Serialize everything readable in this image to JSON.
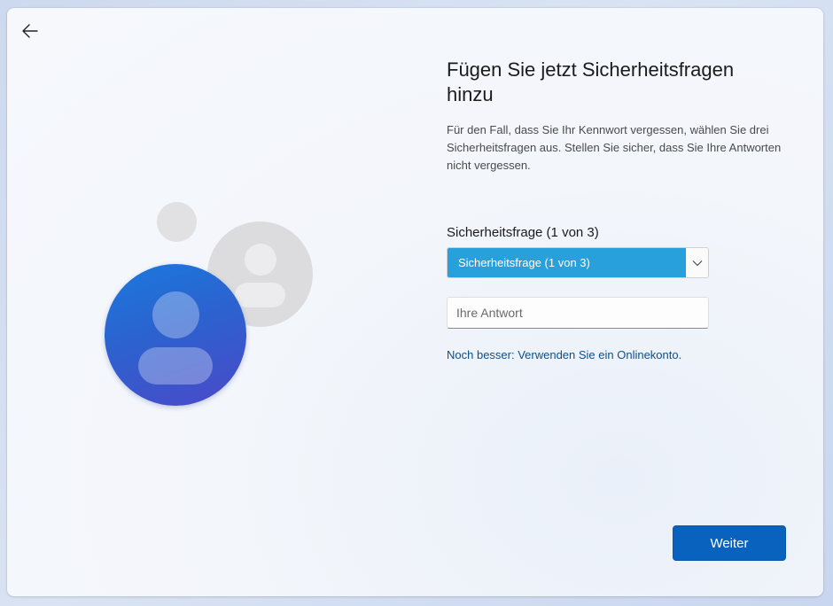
{
  "header": {
    "title": "Fügen Sie jetzt Sicherheitsfragen hinzu",
    "description": "Für den Fall, dass Sie Ihr Kennwort vergessen, wählen Sie drei Sicherheitsfragen aus. Stellen Sie sicher, dass Sie Ihre Antworten nicht vergessen."
  },
  "form": {
    "question_label": "Sicherheitsfrage (1 von 3)",
    "question_selected": "Sicherheitsfrage (1 von 3)",
    "answer_placeholder": "Ihre Antwort",
    "answer_value": ""
  },
  "link": {
    "text": "Noch besser: Verwenden Sie ein Onlinekonto."
  },
  "footer": {
    "next_label": "Weiter"
  },
  "icons": [
    "back-arrow-icon",
    "chevron-down-icon"
  ],
  "colors": {
    "accent": "#0a62bf",
    "selected": "#27a0dc",
    "link": "#0b4f8c"
  }
}
